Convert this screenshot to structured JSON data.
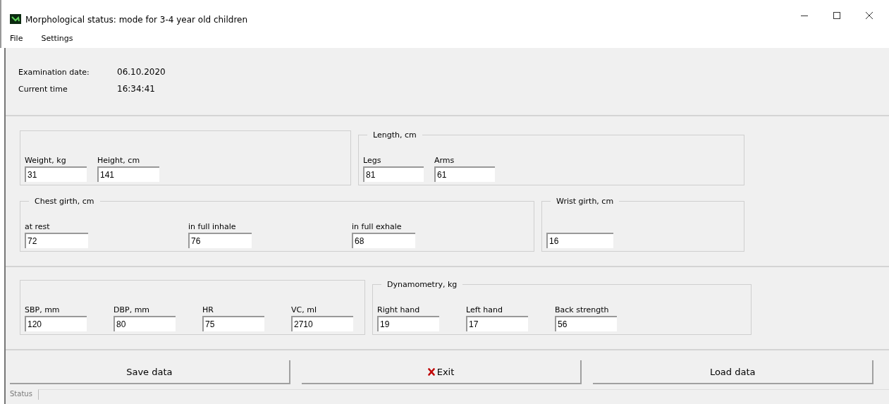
{
  "window": {
    "title": "Morphological status: mode for 3-4 year old children"
  },
  "menu": [
    {
      "label": "File"
    },
    {
      "label": "Settings"
    }
  ],
  "info": [
    {
      "label": "Examination date:",
      "value": "06.10.2020"
    },
    {
      "label": "Current time",
      "value": "16:34:41"
    }
  ],
  "sections": [
    {
      "rows": [
        [
          {
            "fields": [
              {
                "label": "Weight, kg",
                "value": "31"
              },
              {
                "label": "Height, cm",
                "value": "141"
              }
            ]
          },
          {
            "title": "Length, cm",
            "fields": [
              {
                "label": "Legs",
                "value": "81"
              },
              {
                "label": "Arms",
                "value": "61"
              }
            ]
          }
        ],
        [
          {
            "title": "Chest girth, cm",
            "fields": [
              {
                "label": "at rest",
                "value": "72"
              },
              {
                "label": "in full inhale",
                "value": "76"
              },
              {
                "label": "in full exhale",
                "value": "68"
              }
            ]
          },
          {
            "title": "Wrist girth, cm",
            "fields": [
              {
                "value": "16"
              }
            ]
          }
        ]
      ]
    },
    {
      "rows": [
        [
          {
            "fields": [
              {
                "label": "SBP, mm",
                "value": "120"
              },
              {
                "label": "DBP, mm",
                "value": "80"
              },
              {
                "label": "HR",
                "value": "75"
              },
              {
                "label": "VC, ml",
                "value": "2710"
              }
            ]
          },
          {
            "title": "Dynamometry, kg",
            "fields": [
              {
                "label": "Right hand",
                "value": "19"
              },
              {
                "label": "Left hand",
                "value": "17"
              },
              {
                "label": "Back strength",
                "value": "56"
              }
            ]
          }
        ]
      ]
    }
  ],
  "buttons": [
    {
      "label": "Save data",
      "kind": "plain"
    },
    {
      "label": "Exit",
      "kind": "with_icon"
    },
    {
      "label": "Load data",
      "kind": "plain"
    }
  ],
  "status_bar": {
    "label": "Status"
  }
}
